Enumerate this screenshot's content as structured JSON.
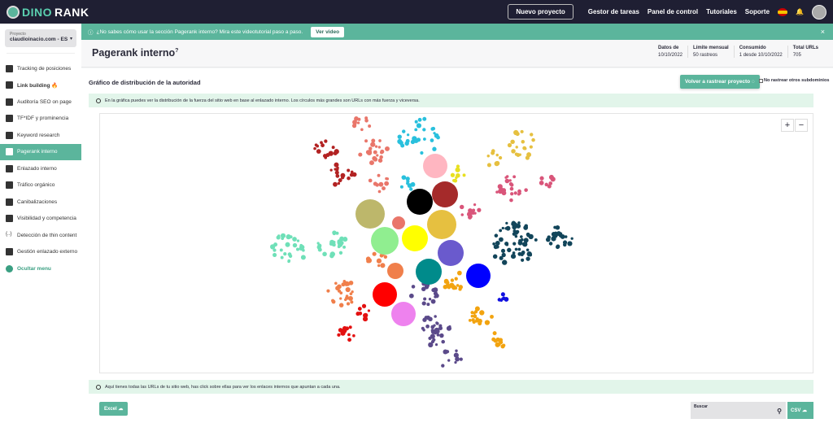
{
  "topbar": {
    "logo_a": "DINO",
    "logo_b": "RANK",
    "new_project": "Nuevo proyecto",
    "links": [
      "Gestor de tareas",
      "Panel de control",
      "Tutoriales",
      "Soporte"
    ]
  },
  "sidebar": {
    "project_label": "Proyecto",
    "project_value": "claudioinacio.com - ES",
    "items": [
      {
        "label": "Tracking de posiciones"
      },
      {
        "label": "Link building 🔥"
      },
      {
        "label": "Auditoría SEO on page"
      },
      {
        "label": "TF*IDF y prominencia"
      },
      {
        "label": "Keyword research"
      },
      {
        "label": "Pagerank interno"
      },
      {
        "label": "Enlazado interno"
      },
      {
        "label": "Tráfico orgánico"
      },
      {
        "label": "Canibalizaciones"
      },
      {
        "label": "Visibilidad y competencia"
      },
      {
        "label": "Detección de thin content"
      },
      {
        "label": "Gestión enlazado externo"
      },
      {
        "label": "Ocultar menu"
      }
    ]
  },
  "banner": {
    "text": "¿No sabes cómo usar la sección Pagerank interno? Mira este videotutorial paso a paso.",
    "button": "Ver video",
    "close": "×"
  },
  "header": {
    "title": "Pagerank interno",
    "stats": [
      {
        "label": "Datos de",
        "value": "10/10/2022"
      },
      {
        "label": "Límite mensual",
        "value": "50 rastreos"
      },
      {
        "label": "Consumido",
        "value": "1 desde 10/10/2022"
      },
      {
        "label": "Total URLs",
        "value": "705"
      }
    ]
  },
  "main": {
    "section_title": "Gráfico de distribución de la autoridad",
    "recrawl_button": "Volver a rastrear proyecto",
    "no_subdomains": "No rastrear otros subdominios",
    "info_top": "En la gráfica puedes ver la distribución de la fuerza del sitio web en base al enlazado interno. Los círculos más grandes son URLs con más fuerza y viceversa.",
    "info_bottom": "Aquí tienes todas las URLs de tu sitio web, has click sobre ellas para ver los enlaces internos que apuntan a cada una.",
    "zoom_in": "+",
    "zoom_out": "−",
    "excel": "Excel",
    "search_label": "Buscar",
    "csv": "CSV"
  },
  "graph_colors": {
    "accent": "#5bb59c",
    "groups": [
      "#b22222",
      "#e9766a",
      "#29c0dd",
      "#e6c040",
      "#d9557a",
      "#12455a",
      "#6fe0b8",
      "#f07f4b",
      "#e31010",
      "#5b4a8a",
      "#f2a30f",
      "#1010e0",
      "#e8e020",
      "#ffb6c1",
      "#a52a2a",
      "#000000",
      "#bdb76b",
      "#90ee90",
      "#ffff00",
      "#6a5acd",
      "#008b8b",
      "#0000ff",
      "#ff0000",
      "#ee82ee"
    ]
  }
}
